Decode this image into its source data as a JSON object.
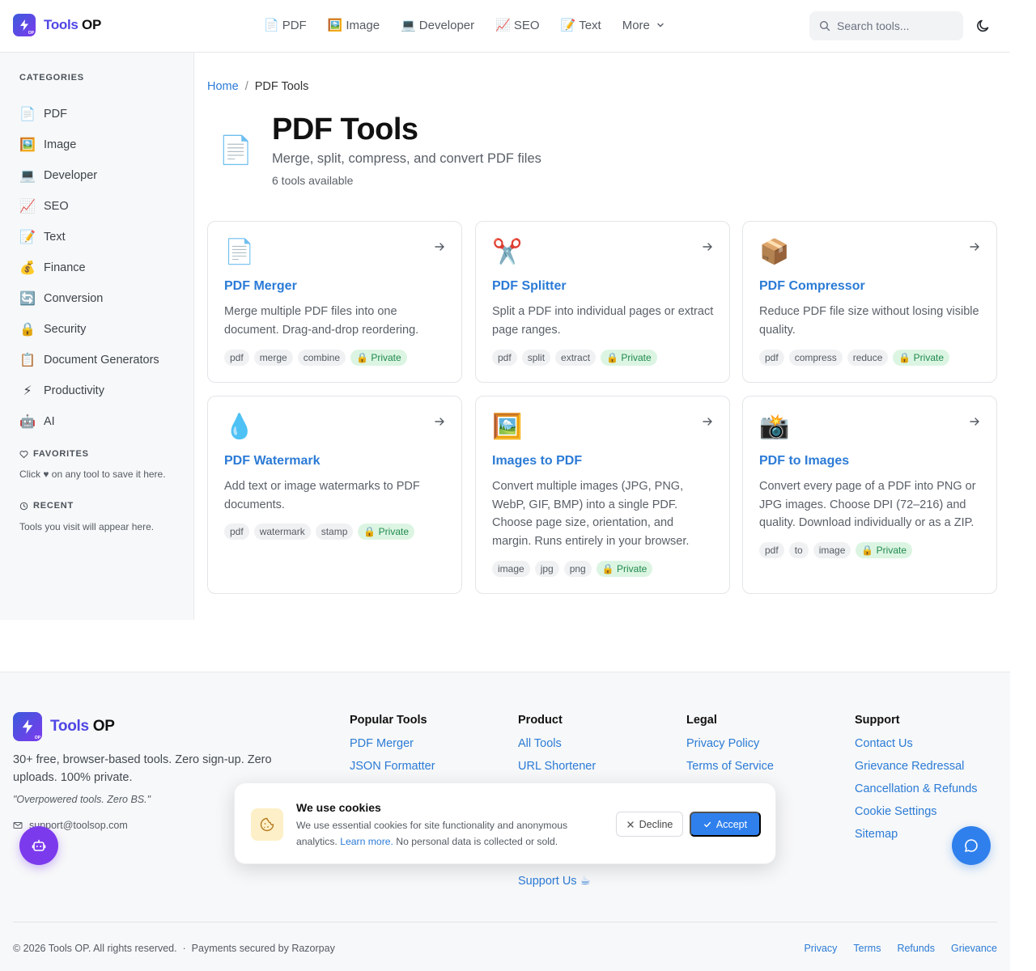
{
  "header": {
    "logo_part1": "Tools",
    "logo_part2": "OP",
    "logo_badge": "OP",
    "nav": [
      {
        "emoji": "📄",
        "label": "PDF"
      },
      {
        "emoji": "🖼️",
        "label": "Image"
      },
      {
        "emoji": "💻",
        "label": "Developer"
      },
      {
        "emoji": "📈",
        "label": "SEO"
      },
      {
        "emoji": "📝",
        "label": "Text"
      }
    ],
    "more_label": "More",
    "search_placeholder": "Search tools..."
  },
  "sidebar": {
    "categories_heading": "CATEGORIES",
    "categories": [
      {
        "emoji": "📄",
        "label": "PDF"
      },
      {
        "emoji": "🖼️",
        "label": "Image"
      },
      {
        "emoji": "💻",
        "label": "Developer"
      },
      {
        "emoji": "📈",
        "label": "SEO"
      },
      {
        "emoji": "📝",
        "label": "Text"
      },
      {
        "emoji": "💰",
        "label": "Finance"
      },
      {
        "emoji": "🔄",
        "label": "Conversion"
      },
      {
        "emoji": "🔒",
        "label": "Security"
      },
      {
        "emoji": "📋",
        "label": "Document Generators"
      },
      {
        "emoji": "⚡",
        "label": "Productivity"
      },
      {
        "emoji": "🤖",
        "label": "AI"
      }
    ],
    "favorites_heading": "FAVORITES",
    "favorites_note": "Click ♥ on any tool to save it here.",
    "recent_heading": "RECENT",
    "recent_note": "Tools you visit will appear here."
  },
  "breadcrumb": {
    "home": "Home",
    "separator": "/",
    "current": "PDF Tools"
  },
  "page": {
    "icon": "📄",
    "title": "PDF Tools",
    "subtitle": "Merge, split, compress, and convert PDF files",
    "count": "6 tools available"
  },
  "tools": [
    {
      "icon": "📄",
      "title": "PDF Merger",
      "desc": "Merge multiple PDF files into one document. Drag-and-drop reordering.",
      "tags": [
        "pdf",
        "merge",
        "combine"
      ],
      "private": "🔒 Private"
    },
    {
      "icon": "✂️",
      "title": "PDF Splitter",
      "desc": "Split a PDF into individual pages or extract page ranges.",
      "tags": [
        "pdf",
        "split",
        "extract"
      ],
      "private": "🔒 Private"
    },
    {
      "icon": "📦",
      "title": "PDF Compressor",
      "desc": "Reduce PDF file size without losing visible quality.",
      "tags": [
        "pdf",
        "compress",
        "reduce"
      ],
      "private": "🔒 Private"
    },
    {
      "icon": "💧",
      "title": "PDF Watermark",
      "desc": "Add text or image watermarks to PDF documents.",
      "tags": [
        "pdf",
        "watermark",
        "stamp"
      ],
      "private": "🔒 Private"
    },
    {
      "icon": "🖼️",
      "title": "Images to PDF",
      "desc": "Convert multiple images (JPG, PNG, WebP, GIF, BMP) into a single PDF. Choose page size, orientation, and margin. Runs entirely in your browser.",
      "tags": [
        "image",
        "jpg",
        "png"
      ],
      "private": "🔒 Private"
    },
    {
      "icon": "📸",
      "title": "PDF to Images",
      "desc": "Convert every page of a PDF into PNG or JPG images. Choose DPI (72–216) and quality. Download individually or as a ZIP.",
      "tags": [
        "pdf",
        "to",
        "image"
      ],
      "private": "🔒 Private"
    }
  ],
  "footer": {
    "logo_part1": "Tools",
    "logo_part2": "OP",
    "logo_badge": "OP",
    "description": "30+ free, browser-based tools. Zero sign-up. Zero uploads. 100% private.",
    "tagline": "\"Overpowered tools. Zero BS.\"",
    "email": "support@toolsop.com",
    "columns": [
      {
        "heading": "Popular Tools",
        "links": [
          "PDF Merger",
          "JSON Formatter"
        ]
      },
      {
        "heading": "Product",
        "links": [
          "All Tools",
          "URL Shortener"
        ]
      },
      {
        "heading": "Legal",
        "links": [
          "Privacy Policy",
          "Terms of Service"
        ]
      },
      {
        "heading": "Support",
        "links": [
          "Contact Us",
          "Grievance Redressal",
          "Cancellation & Refunds",
          "Cookie Settings",
          "Sitemap"
        ]
      }
    ],
    "support_us": "Support Us ☕",
    "copyright": "© 2026 Tools OP. All rights reserved.  ·  Payments secured by Razorpay",
    "bottom_links": [
      "Privacy",
      "Terms",
      "Refunds",
      "Grievance"
    ]
  },
  "cookie": {
    "title": "We use cookies",
    "text_before": "We use essential cookies for site functionality and anonymous analytics. ",
    "learn_more": "Learn more.",
    "text_after": " No personal data is collected or sold.",
    "decline": "Decline",
    "accept": "Accept"
  },
  "colors": {
    "brand": "#4f46e5",
    "link": "#2b7bd6",
    "accent": "#2f80ed",
    "bot": "#7c3aed",
    "private_bg": "#dcf5e3"
  }
}
